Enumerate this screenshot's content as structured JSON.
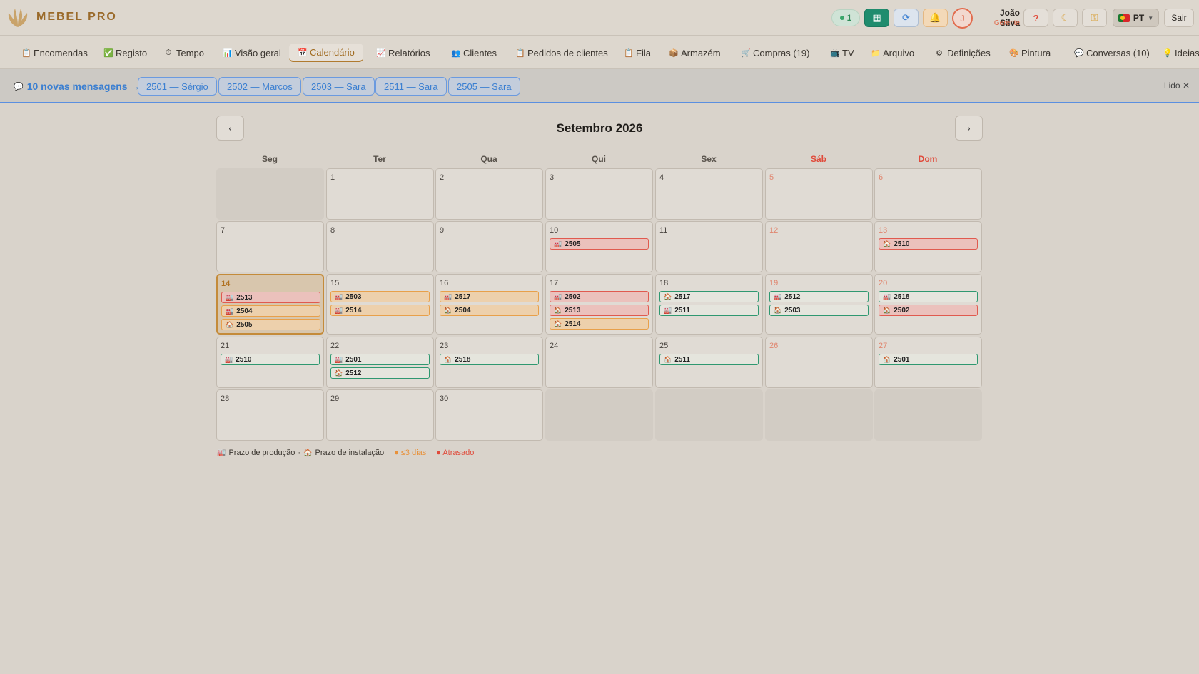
{
  "header": {
    "brand": "MEBEL PRO",
    "online_count": "1",
    "user_name": "João Silva",
    "user_role": "Gerente",
    "user_initial": "J",
    "lang": "PT",
    "logout": "Sair",
    "help": "?"
  },
  "nav": [
    {
      "label": "Encomendas",
      "icon": "clipboard-icon",
      "glyph": "📋"
    },
    {
      "label": "Registo",
      "icon": "check-box-icon",
      "glyph": "✅"
    },
    {
      "label": "Tempo",
      "icon": "stopwatch-icon",
      "glyph": "⏱"
    },
    {
      "label": "Visão geral",
      "icon": "bar-chart-icon",
      "glyph": "📊"
    },
    {
      "label": "Calendário",
      "icon": "calendar-icon",
      "glyph": "📅"
    },
    {
      "label": "Relatórios",
      "icon": "line-chart-icon",
      "glyph": "📈"
    },
    {
      "label": "Clientes",
      "icon": "users-icon",
      "glyph": "👥"
    },
    {
      "label": "Pedidos de clientes",
      "icon": "clipboard-icon",
      "glyph": "📋"
    },
    {
      "label": "Fila",
      "icon": "clipboard-icon",
      "glyph": "📋"
    },
    {
      "label": "Armazém",
      "icon": "box-icon",
      "glyph": "📦"
    },
    {
      "label": "Compras (19)",
      "icon": "cart-icon",
      "glyph": "🛒"
    },
    {
      "label": "TV",
      "icon": "tv-icon",
      "glyph": "📺"
    },
    {
      "label": "Arquivo",
      "icon": "folder-icon",
      "glyph": "📁"
    },
    {
      "label": "Definições",
      "icon": "gear-icon",
      "glyph": "⚙"
    },
    {
      "label": "Pintura",
      "icon": "paint-icon",
      "glyph": "🎨"
    },
    {
      "label": "Conversas (10)",
      "icon": "chat-icon",
      "glyph": "💬"
    },
    {
      "label": "Ideias",
      "icon": "bulb-icon",
      "glyph": "💡"
    }
  ],
  "messages": {
    "link": "10 novas mensagens →",
    "chips": [
      "2501 — Sérgio",
      "2502 — Marcos",
      "2503 — Sara",
      "2511 — Sara",
      "2505 — Sara"
    ],
    "read": "Lido ✕"
  },
  "calendar": {
    "title": "Setembro 2026",
    "prev": "‹",
    "next": "›",
    "weekdays": [
      "Seg",
      "Ter",
      "Qua",
      "Qui",
      "Sex",
      "Sáb",
      "Dom"
    ],
    "today": 14,
    "days": [
      {
        "day": 1,
        "events": []
      },
      {
        "day": 2,
        "events": []
      },
      {
        "day": 3,
        "events": []
      },
      {
        "day": 4,
        "events": []
      },
      {
        "day": 5,
        "events": []
      },
      {
        "day": 6,
        "events": []
      },
      {
        "day": 7,
        "events": []
      },
      {
        "day": 8,
        "events": []
      },
      {
        "day": 9,
        "events": []
      },
      {
        "day": 10,
        "events": [
          {
            "id": "2505",
            "kind": "production",
            "status": "late"
          }
        ]
      },
      {
        "day": 11,
        "events": []
      },
      {
        "day": 12,
        "events": []
      },
      {
        "day": 13,
        "events": [
          {
            "id": "2510",
            "kind": "installation",
            "status": "late"
          }
        ]
      },
      {
        "day": 14,
        "events": [
          {
            "id": "2513",
            "kind": "production",
            "status": "late"
          },
          {
            "id": "2504",
            "kind": "production",
            "status": "soon"
          },
          {
            "id": "2505",
            "kind": "installation",
            "status": "soon"
          }
        ]
      },
      {
        "day": 15,
        "events": [
          {
            "id": "2503",
            "kind": "production",
            "status": "soon"
          },
          {
            "id": "2514",
            "kind": "production",
            "status": "soon"
          }
        ]
      },
      {
        "day": 16,
        "events": [
          {
            "id": "2517",
            "kind": "production",
            "status": "soon"
          },
          {
            "id": "2504",
            "kind": "installation",
            "status": "soon"
          }
        ]
      },
      {
        "day": 17,
        "events": [
          {
            "id": "2502",
            "kind": "production",
            "status": "late"
          },
          {
            "id": "2513",
            "kind": "installation",
            "status": "late"
          },
          {
            "id": "2514",
            "kind": "installation",
            "status": "soon"
          }
        ]
      },
      {
        "day": 18,
        "events": [
          {
            "id": "2517",
            "kind": "installation",
            "status": "ok"
          },
          {
            "id": "2511",
            "kind": "production",
            "status": "ok"
          }
        ]
      },
      {
        "day": 19,
        "events": [
          {
            "id": "2512",
            "kind": "production",
            "status": "ok"
          },
          {
            "id": "2503",
            "kind": "installation",
            "status": "ok"
          }
        ]
      },
      {
        "day": 20,
        "events": [
          {
            "id": "2518",
            "kind": "production",
            "status": "ok"
          },
          {
            "id": "2502",
            "kind": "installation",
            "status": "late"
          }
        ]
      },
      {
        "day": 21,
        "events": [
          {
            "id": "2510",
            "kind": "production",
            "status": "ok"
          }
        ]
      },
      {
        "day": 22,
        "events": [
          {
            "id": "2501",
            "kind": "production",
            "status": "ok"
          },
          {
            "id": "2512",
            "kind": "installation",
            "status": "ok"
          }
        ]
      },
      {
        "day": 23,
        "events": [
          {
            "id": "2518",
            "kind": "installation",
            "status": "ok"
          }
        ]
      },
      {
        "day": 24,
        "events": []
      },
      {
        "day": 25,
        "events": [
          {
            "id": "2511",
            "kind": "installation",
            "status": "ok"
          }
        ]
      },
      {
        "day": 26,
        "events": []
      },
      {
        "day": 27,
        "events": [
          {
            "id": "2501",
            "kind": "installation",
            "status": "ok"
          }
        ]
      },
      {
        "day": 28,
        "events": []
      },
      {
        "day": 29,
        "events": []
      },
      {
        "day": 30,
        "events": []
      }
    ]
  },
  "legend": {
    "production": "Prazo de produção",
    "sep": "·",
    "installation": "Prazo de instalação",
    "soon": "≤3 dias",
    "late": "Atrasado"
  },
  "icons": {
    "production": "🏭",
    "installation": "🏠"
  },
  "colors": {
    "accent": "#a06a1f",
    "late": "#e05a4f",
    "soon": "#e8a04a",
    "ok": "#2f9870",
    "link": "#3b7fd1"
  }
}
